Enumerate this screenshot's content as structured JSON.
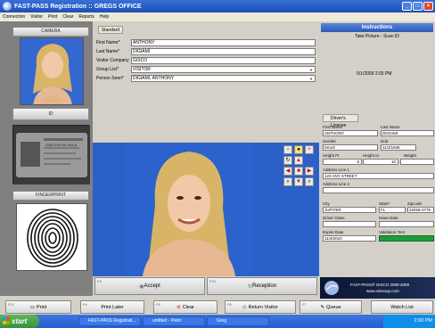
{
  "window": {
    "title": "FAST-PASS Registration :: GREGS OFFICE"
  },
  "menu": [
    "Connection",
    "Visitor",
    "Print",
    "Clear",
    "Reports",
    "Help"
  ],
  "left": {
    "camera_label": "CAMERA",
    "id_label": "ID",
    "fingerprint_label": "FINGERPRINT",
    "id_card_text": "2250-976-4K-004-8"
  },
  "form": {
    "tab": "Standard",
    "fields": [
      {
        "label": "First Name*",
        "value": "ANTHONY"
      },
      {
        "label": "Last Name*",
        "value": "DIGIAMI"
      },
      {
        "label": "Visitor Company",
        "value": "GISCO"
      },
      {
        "label": "Group List*",
        "value": "VISITOR"
      },
      {
        "label": "Person Seen*",
        "value": "DIGIAMI, ANTHONY"
      }
    ]
  },
  "instructions": {
    "header": "Instructions",
    "text": "Take Picture - Scan ID",
    "datetime": "5/1/2009 2:00 PM"
  },
  "license": {
    "tab": "Driver's License",
    "first_name_label": "First Name",
    "first_name": "ANTHONY",
    "last_name_label": "Last Name",
    "last_name": "DIGIAMI",
    "gender_label": "Gender",
    "gender": "MALE",
    "dob_label": "Dob",
    "dob": "11/4/1945",
    "height_ft_label": "Height Ft",
    "height_ft": "5",
    "height_in_label": "Height In",
    "height_in": "10",
    "weight_label": "Weight",
    "weight": "",
    "addr1_label": "Address Line 1",
    "addr1": "123 ANY STREET",
    "addr2_label": "Address Line 2",
    "addr2": "",
    "city_label": "City",
    "city": "JUPITER",
    "state_label": "State*",
    "state": "FL",
    "zip_label": "Zipcode",
    "zip": "33458-3775",
    "class_label": "Driver Class",
    "class": "",
    "issue_label": "Issue Date",
    "issue": "",
    "expire_label": "Expire Date",
    "expire": "11/4/2010",
    "validation_label": "Validation Test",
    "validation": ""
  },
  "actions": {
    "accept_key": "F9",
    "accept": "Accept",
    "reception_key": "F10",
    "reception": "Reception",
    "logo_line1": "FAST-PASS® GISCO 2000-2009",
    "logo_line2": "www.visisoup.com"
  },
  "bottom": [
    {
      "key": "F12",
      "label": "Print"
    },
    {
      "key": "F4",
      "label": "Print Later"
    },
    {
      "key": "F5",
      "label": "Clear"
    },
    {
      "key": "F6",
      "label": "Return Visitor"
    },
    {
      "key": "F7",
      "label": "Queue"
    },
    {
      "key": "",
      "label": "Watch List"
    }
  ],
  "taskbar": {
    "start": "start",
    "tasks": [
      "FAST-PASS Registrati...",
      "untitled - Paint",
      "Greg"
    ],
    "clock": "2:00 PM"
  },
  "colors": {
    "accent": "#2c5ab8",
    "photo_bg": "#2b62cc",
    "validation_green": "#1a9e3a"
  }
}
